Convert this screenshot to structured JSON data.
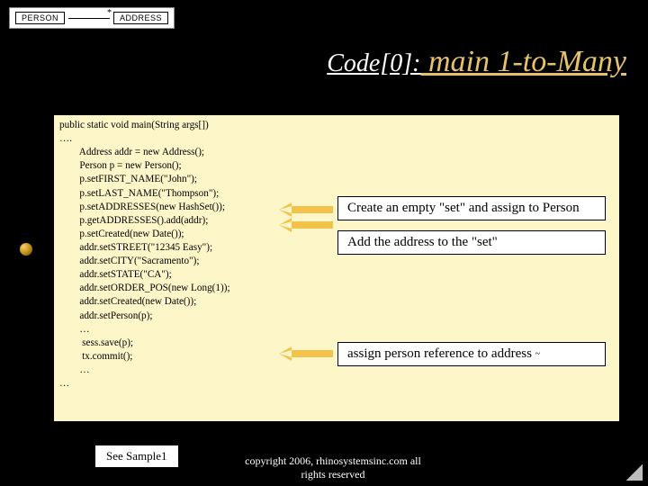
{
  "erd": {
    "left": "PERSON",
    "right": "ADDRESS",
    "card": "*"
  },
  "title": {
    "prefix": "Code[0]:",
    "main": " main 1-to-Many"
  },
  "code": "public static void main(String args[])\n….\n        Address addr = new Address();\n        Person p = new Person();\n        p.setFIRST_NAME(\"John\");\n        p.setLAST_NAME(\"Thompson\");\n        p.setADDRESSES(new HashSet());\n        p.getADDRESSES().add(addr);\n        p.setCreated(new Date());\n        addr.setSTREET(\"12345 Easy\");\n        addr.setCITY(\"Sacramento\");\n        addr.setSTATE(\"CA\");\n        addr.setORDER_POS(new Long(1));\n        addr.setCreated(new Date());\n        addr.setPerson(p);\n        …\n         sess.save(p);\n         tx.commit();\n        …\n…",
  "notes": {
    "n1": "Create an empty \"set\" and assign to Person",
    "n2": "Add the address to the \"set\"",
    "n3_a": "assign person reference to address ",
    "n3_b": "~"
  },
  "see": "See Sample1",
  "copyright": "copyright 2006, rhinosystemsinc.com all rights reserved"
}
